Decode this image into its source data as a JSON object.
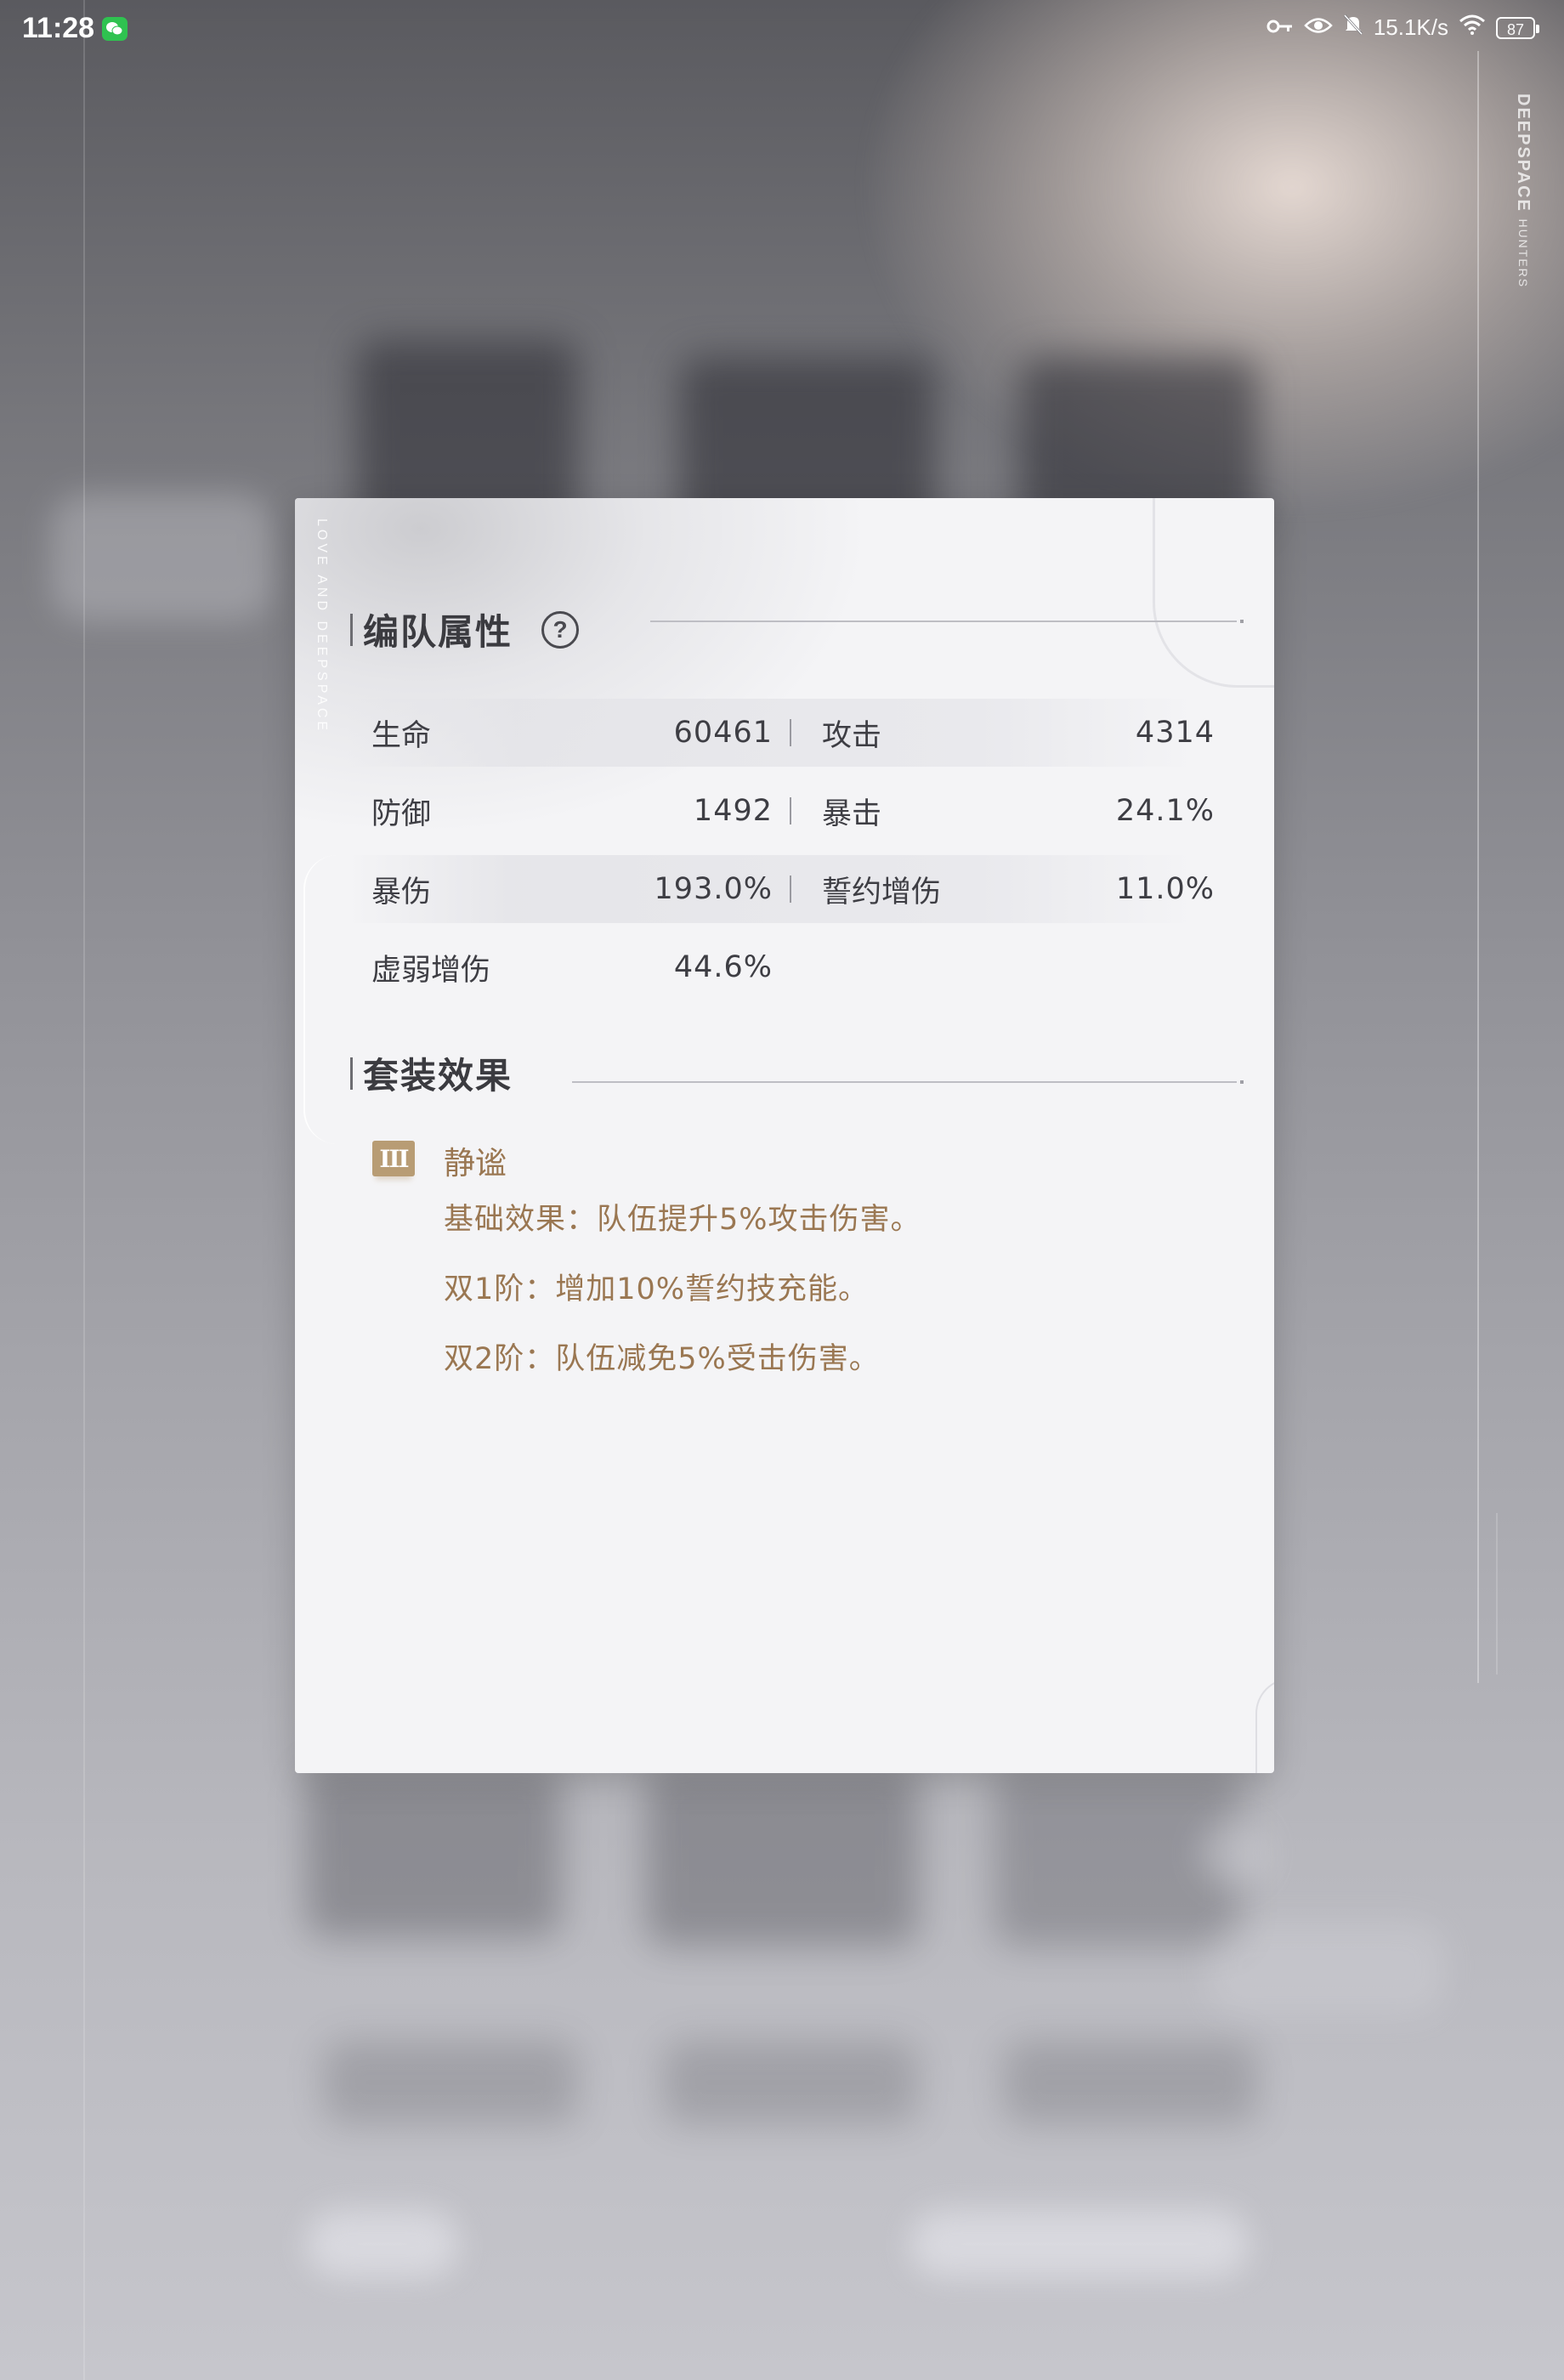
{
  "status_bar": {
    "time": "11:28",
    "net_speed": "15.1K/s",
    "battery": "87",
    "icons": [
      "wechat-icon",
      "key-icon",
      "eye-icon",
      "bell-off-icon",
      "wifi-icon",
      "battery-icon"
    ]
  },
  "brand": {
    "main": "DEEPSPACE",
    "sub": "HUNTERS"
  },
  "panel": {
    "side_text": "LOVE AND DEEPSPACE",
    "team_stats": {
      "title": "编队属性",
      "help_icon": "question-circle-icon",
      "rows": [
        {
          "left_label": "生命",
          "left_value": "60461",
          "right_label": "攻击",
          "right_value": "4314"
        },
        {
          "left_label": "防御",
          "left_value": "1492",
          "right_label": "暴击",
          "right_value": "24.1%"
        },
        {
          "left_label": "暴伤",
          "left_value": "193.0%",
          "right_label": "誓约增伤",
          "right_value": "11.0%"
        },
        {
          "left_label": "虚弱增伤",
          "left_value": "44.6%",
          "right_label": "",
          "right_value": ""
        }
      ]
    },
    "set_effect": {
      "title": "套装效果",
      "badge": "III",
      "name": "静谧",
      "effects": [
        "基础效果：队伍提升5%攻击伤害。",
        "双1阶：增加10%誓约技充能。",
        "双2阶：队伍减免5%受击伤害。"
      ]
    }
  },
  "colors": {
    "panel_bg": "#f4f4f6",
    "title": "#3b3b40",
    "stat_text": "#3e3e44",
    "set_accent": "#b89c74",
    "set_text": "#9a7752"
  }
}
